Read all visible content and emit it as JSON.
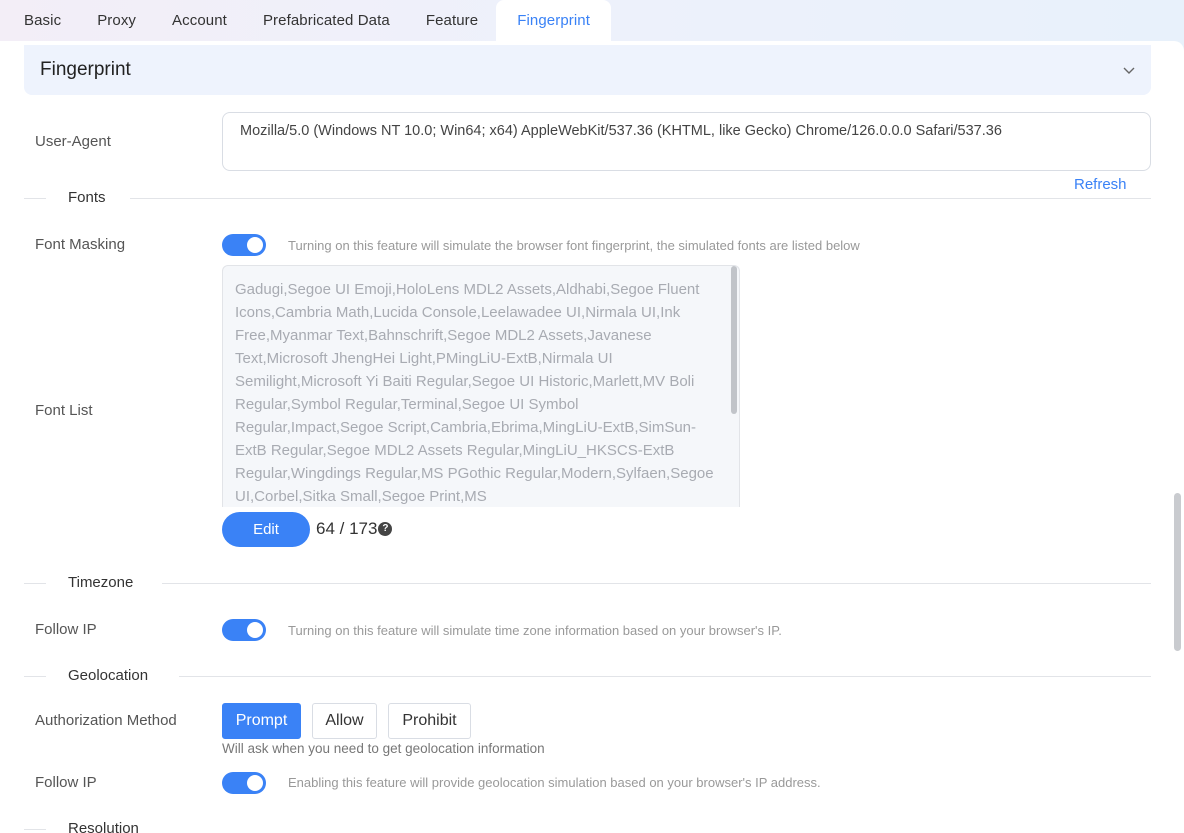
{
  "tabs": [
    "Basic",
    "Proxy",
    "Account",
    "Prefabricated Data",
    "Feature",
    "Fingerprint"
  ],
  "active_tab": "Fingerprint",
  "section": {
    "title": "Fingerprint"
  },
  "user_agent": {
    "label": "User-Agent",
    "value": "Mozilla/5.0 (Windows NT 10.0; Win64; x64) AppleWebKit/537.36 (KHTML, like Gecko) Chrome/126.0.0.0 Safari/537.36",
    "refresh_label": "Refresh"
  },
  "fonts": {
    "divider": "Fonts",
    "masking_label": "Font Masking",
    "masking_on": true,
    "masking_hint": "Turning on this feature will simulate the browser font fingerprint, the simulated fonts are listed below",
    "list_label": "Font List",
    "list_text": "Gadugi,Segoe UI Emoji,HoloLens MDL2 Assets,Aldhabi,Segoe Fluent Icons,Cambria Math,Lucida Console,Leelawadee UI,Nirmala UI,Ink Free,Myanmar Text,Bahnschrift,Segoe MDL2 Assets,Javanese Text,Microsoft JhengHei Light,PMingLiU-ExtB,Nirmala UI Semilight,Microsoft Yi Baiti Regular,Segoe UI Historic,Marlett,MV Boli Regular,Symbol Regular,Terminal,Segoe UI Symbol Regular,Impact,Segoe Script,Cambria,Ebrima,MingLiU-ExtB,SimSun-ExtB Regular,Segoe MDL2 Assets Regular,MingLiU_HKSCS-ExtB Regular,Wingdings Regular,MS PGothic Regular,Modern,Sylfaen,Segoe UI,Corbel,Sitka Small,Segoe Print,MS",
    "edit_label": "Edit",
    "count": "64 / 173"
  },
  "timezone": {
    "divider": "Timezone",
    "follow_label": "Follow IP",
    "follow_on": true,
    "follow_hint": "Turning on this feature will simulate time zone information based on your browser's IP."
  },
  "geolocation": {
    "divider": "Geolocation",
    "auth_label": "Authorization Method",
    "options": [
      "Prompt",
      "Allow",
      "Prohibit"
    ],
    "selected": "Prompt",
    "auth_hint": "Will ask when you need to get geolocation information",
    "follow_label": "Follow IP",
    "follow_on": true,
    "follow_hint": "Enabling this feature will provide geolocation simulation based on your browser's IP address."
  },
  "resolution": {
    "divider": "Resolution"
  },
  "colors": {
    "accent": "#3a82f6",
    "header_bg": "#eef3fd"
  }
}
